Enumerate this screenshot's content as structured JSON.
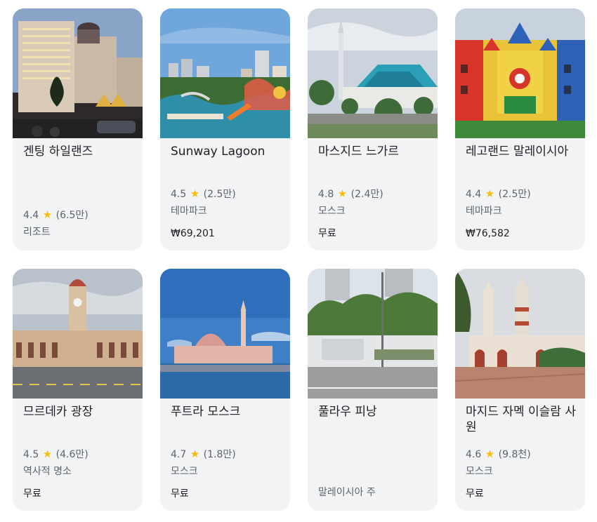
{
  "cards": [
    {
      "title": "겐팅 하일랜즈",
      "rating": "4.4",
      "reviews": "(6.5만)",
      "category": "리조트",
      "price": "",
      "image": "resort-hotel-photo"
    },
    {
      "title": "Sunway Lagoon",
      "rating": "4.5",
      "reviews": "(2.5만)",
      "category": "테마파크",
      "price": "₩69,201",
      "image": "waterpark-photo"
    },
    {
      "title": "마스지드 느가르",
      "rating": "4.8",
      "reviews": "(2.4만)",
      "category": "모스크",
      "price": "무료",
      "image": "national-mosque-photo"
    },
    {
      "title": "레고랜드 말레이시아",
      "rating": "4.4",
      "reviews": "(2.5만)",
      "category": "테마파크",
      "price": "₩76,582",
      "image": "legoland-photo"
    },
    {
      "title": "므르데카 광장",
      "rating": "4.5",
      "reviews": "(4.6만)",
      "category": "역사적 명소",
      "price": "무료",
      "image": "colonial-building-photo"
    },
    {
      "title": "푸트라 모스크",
      "rating": "4.7",
      "reviews": "(1.8만)",
      "category": "모스크",
      "price": "무료",
      "image": "pink-mosque-photo"
    },
    {
      "title": "풀라우 피낭",
      "rating": "",
      "reviews": "",
      "category": "말레이시아 주",
      "price": "",
      "image": "penang-street-photo"
    },
    {
      "title": "마지드 자멕 이슬람 사원",
      "rating": "4.6",
      "reviews": "(9.8천)",
      "category": "모스크",
      "price": "무료",
      "image": "jamek-mosque-photo"
    }
  ],
  "colors": {
    "card_bg": "#f1f3f4",
    "star": "#fbbc04",
    "muted": "#5f6368",
    "text": "#202124"
  }
}
